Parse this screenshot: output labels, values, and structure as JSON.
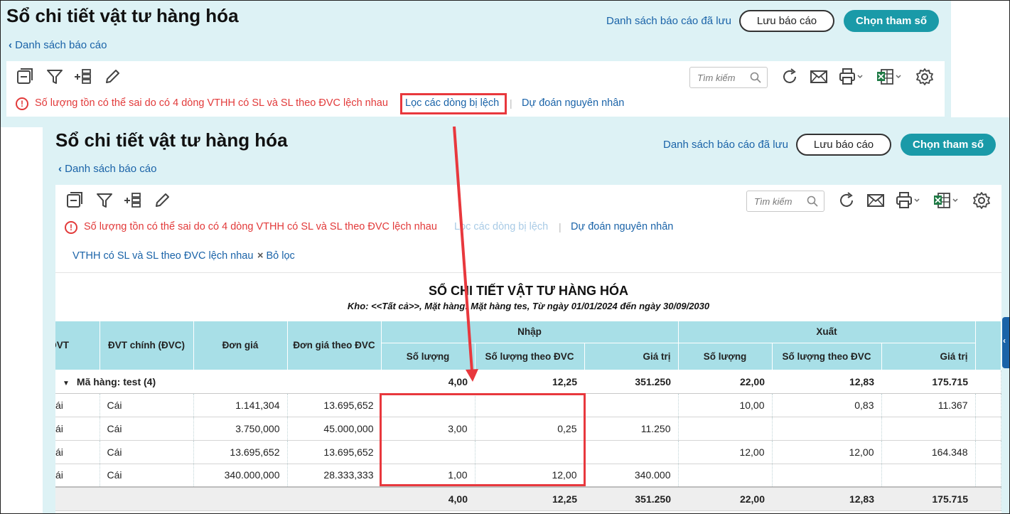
{
  "header": {
    "title": "Sổ chi tiết vật tư hàng hóa",
    "back_link": "Danh sách báo cáo",
    "saved_reports_link": "Danh sách báo cáo đã lưu",
    "save_button": "Lưu báo cáo",
    "params_button": "Chọn tham số"
  },
  "toolbar": {
    "search_placeholder": "Tìm kiếm",
    "icons": [
      "collapse-icon",
      "filter-icon",
      "add-column-icon",
      "edit-icon",
      "refresh-icon",
      "email-icon",
      "print-icon",
      "excel-icon",
      "settings-icon"
    ]
  },
  "warning": {
    "message": "Số lượng tồn có thể sai do có 4 dòng VTHH có SL và SL theo ĐVC lệch nhau",
    "filter_link": "Lọc các dòng bị lệch",
    "separator": "|",
    "predict_link": "Dự đoán nguyên nhân"
  },
  "active_filter": {
    "label": "VTHH có SL và SL theo ĐVC lệch nhau",
    "clear_icon": "×",
    "clear_label": "Bỏ lọc"
  },
  "report": {
    "title": "SỔ CHI TIẾT VẬT TƯ HÀNG HÓA",
    "subtitle": "Kho: <<Tất cả>>, Mặt hàng: Mặt hàng tes, Từ ngày 01/01/2024 đến ngày 30/09/2030"
  },
  "table": {
    "headers": {
      "dvt": "ĐVT",
      "dvt_chinh": "ĐVT chính (ĐVC)",
      "don_gia": "Đơn giá",
      "don_gia_theo_dvc": "Đơn giá theo ĐVC",
      "nhap": "Nhập",
      "xuat": "Xuất",
      "so_luong": "Số lượng",
      "so_luong_theo_dvc": "Số lượng theo ĐVC",
      "gia_tri": "Giá trị"
    },
    "group": {
      "label": "Mã hàng: test (4)",
      "nhap_sl": "4,00",
      "nhap_sl_dvc": "12,25",
      "nhap_gt": "351.250",
      "xuat_sl": "22,00",
      "xuat_sl_dvc": "12,83",
      "xuat_gt": "175.715"
    },
    "rows": [
      {
        "dvt": "ái",
        "dvc": "Cái",
        "don_gia": "1.141,304",
        "don_gia_dvc": "13.695,652",
        "nhap_sl": "",
        "nhap_sl_dvc": "",
        "nhap_gt": "",
        "xuat_sl": "10,00",
        "xuat_sl_dvc": "0,83",
        "xuat_gt": "11.367"
      },
      {
        "dvt": "ái",
        "dvc": "Cái",
        "don_gia": "3.750,000",
        "don_gia_dvc": "45.000,000",
        "nhap_sl": "3,00",
        "nhap_sl_dvc": "0,25",
        "nhap_gt": "11.250",
        "xuat_sl": "",
        "xuat_sl_dvc": "",
        "xuat_gt": ""
      },
      {
        "dvt": "ái",
        "dvc": "Cái",
        "don_gia": "13.695,652",
        "don_gia_dvc": "13.695,652",
        "nhap_sl": "",
        "nhap_sl_dvc": "",
        "nhap_gt": "",
        "xuat_sl": "12,00",
        "xuat_sl_dvc": "12,00",
        "xuat_gt": "164.348"
      },
      {
        "dvt": "ái",
        "dvc": "Cái",
        "don_gia": "340.000,000",
        "don_gia_dvc": "28.333,333",
        "nhap_sl": "1,00",
        "nhap_sl_dvc": "12,00",
        "nhap_gt": "340.000",
        "xuat_sl": "",
        "xuat_sl_dvc": "",
        "xuat_gt": ""
      }
    ],
    "total": {
      "nhap_sl": "4,00",
      "nhap_sl_dvc": "12,25",
      "nhap_gt": "351.250",
      "xuat_sl": "22,00",
      "xuat_sl_dvc": "12,83",
      "xuat_gt": "175.715"
    }
  },
  "colors": {
    "panel_bg": "#ddf2f5",
    "accent": "#1a9aa8",
    "link": "#1a63a8",
    "warning": "#e23a3a",
    "highlight": "#e8383d",
    "header_bg": "#a8dfe7"
  }
}
